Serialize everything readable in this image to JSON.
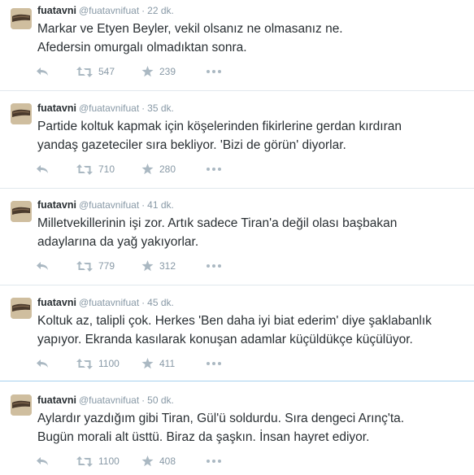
{
  "tweets": [
    {
      "fullname": "fuatavni",
      "username": "@fuatavnifuat",
      "separator": "·",
      "time": "22 dk.",
      "line1": "Markar ve Etyen Beyler, vekil olsanız ne olmasanız ne.",
      "line2": "Afedersin omurgalı olmadıktan sonra.",
      "retweets": "547",
      "favorites": "239"
    },
    {
      "fullname": "fuatavni",
      "username": "@fuatavnifuat",
      "separator": "·",
      "time": "35 dk.",
      "line1": "Partide koltuk kapmak için köşelerinden fikirlerine gerdan kırdıran",
      "line2": "yandaş gazeteciler sıra bekliyor. 'Bizi de görün' diyorlar.",
      "retweets": "710",
      "favorites": "280"
    },
    {
      "fullname": "fuatavni",
      "username": "@fuatavnifuat",
      "separator": "·",
      "time": "41 dk.",
      "line1": "Milletvekillerinin işi zor. Artık sadece Tiran'a değil olası başbakan",
      "line2": "adaylarına da yağ yakıyorlar.",
      "retweets": "779",
      "favorites": "312"
    },
    {
      "fullname": "fuatavni",
      "username": "@fuatavnifuat",
      "separator": "·",
      "time": "45 dk.",
      "line1": "Koltuk az, talipli çok. Herkes 'Ben daha iyi biat ederim' diye şaklabanlık",
      "line2": "yapıyor. Ekranda kasılarak konuşan adamlar küçüldükçe küçülüyor.",
      "retweets": "1100",
      "favorites": "411"
    },
    {
      "fullname": "fuatavni",
      "username": "@fuatavnifuat",
      "separator": "·",
      "time": "50 dk.",
      "line1": "Aylardır yazdığım gibi Tiran, Gül'ü soldurdu. Sıra dengeci Arınç'ta.",
      "line2": "Bugün morali alt üsttü. Biraz da şaşkın. İnsan hayret ediyor.",
      "retweets": "1100",
      "favorites": "408"
    }
  ],
  "icons": {
    "reply": "reply-icon",
    "retweet": "retweet-icon",
    "favorite": "favorite-star-icon",
    "more": "more-dots-icon",
    "avatar": "profile-avatar"
  },
  "colors": {
    "text": "#292f33",
    "meta": "#8899a6",
    "action": "#aab8c2",
    "divider": "#e1e8ed",
    "divider_focused": "#a6d1ee"
  }
}
